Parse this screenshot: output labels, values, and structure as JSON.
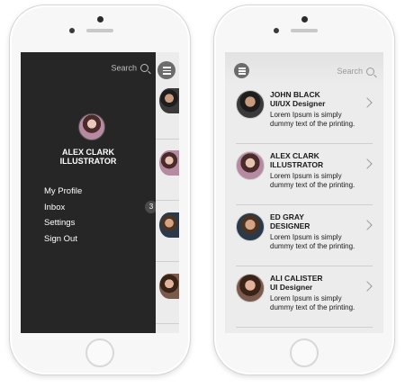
{
  "menu": {
    "search_label": "Search",
    "profile_name_line1": "ALEX CLARK",
    "profile_name_line2": "ILLUSTRATOR",
    "items": [
      {
        "label": "My Profile"
      },
      {
        "label": "Inbox",
        "badge": "3"
      },
      {
        "label": "Settings"
      },
      {
        "label": "Sign Out"
      }
    ]
  },
  "list_screen": {
    "search_label": "Search",
    "contacts": [
      {
        "name": "JOHN BLACK",
        "role": "UI/UX Designer",
        "desc": "Lorem Ipsum is simply dummy text of the printing."
      },
      {
        "name": "ALEX CLARK",
        "role": "ILLUSTRATOR",
        "desc": "Lorem Ipsum is simply dummy text of the printing."
      },
      {
        "name": "ED GRAY",
        "role": "DESIGNER",
        "desc": "Lorem Ipsum is simply dummy text of the printing."
      },
      {
        "name": "ALI CALISTER",
        "role": "UI Designer",
        "desc": "Lorem Ipsum is simply dummy text of the printing."
      }
    ]
  },
  "colors": {
    "menu_bg": "#262626",
    "screen_bg": "#ececec",
    "badge_bg": "#4a4a4a",
    "hamburger_bg": "#6c6c6c"
  },
  "icons": [
    "search-icon",
    "hamburger-icon",
    "chevron-right-icon",
    "home-button"
  ]
}
